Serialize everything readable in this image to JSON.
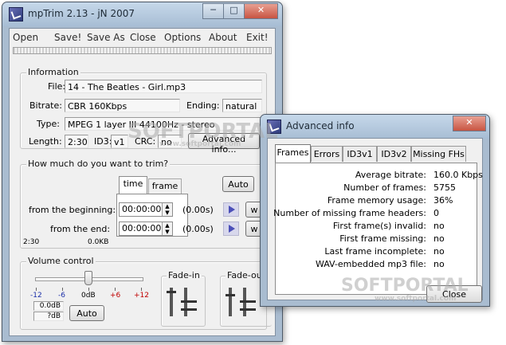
{
  "main_window": {
    "title": "mpTrim 2.13 - jN 2007",
    "caption_minimize": "─",
    "caption_maximize": "□",
    "caption_close": "✕",
    "menu": [
      "Open",
      "Save!",
      "Save As",
      "Close",
      "Options",
      "About",
      "Exit!"
    ],
    "information": {
      "legend": "Information",
      "file_label": "File:",
      "file_value": "14 - The Beatles - Girl.mp3",
      "bitrate_label": "Bitrate:",
      "bitrate_value": "CBR 160Kbps",
      "ending_label": "Ending:",
      "ending_value": "natural",
      "type_label": "Type:",
      "type_value": "MPEG 1 layer III 44100Hz - stereo",
      "length_label": "Length:",
      "length_value": "2:30",
      "id3_label": "ID3:",
      "id3_value": "v1",
      "crc_label": "CRC:",
      "crc_value": "no",
      "advanced_button": "Advanced info..."
    },
    "trim": {
      "legend": "How much do you want to trim?",
      "tabs": [
        "time",
        "frame"
      ],
      "auto_button": "Auto",
      "beginning_label": "from the beginning:",
      "beginning_value": "00:00:00",
      "beginning_seconds": "(0.00s)",
      "end_label": "from the end:",
      "end_value": "00:00:00",
      "end_seconds": "(0.00s)",
      "side_button_label": "w",
      "footer_length": "2:30",
      "footer_size": "0.0KB"
    },
    "volume": {
      "legend": "Volume control",
      "scale": [
        "-12",
        "-6",
        "0dB",
        "+6",
        "+12"
      ],
      "level": 0.5,
      "gain_value": "0.0dB",
      "peak_value": "?dB",
      "auto_button": "Auto",
      "fade_in_legend": "Fade-in",
      "fade_out_legend": "Fade-out"
    }
  },
  "advanced_dialog": {
    "title": "Advanced info",
    "tabs": [
      "Frames",
      "Errors",
      "ID3v1",
      "ID3v2",
      "Missing FHs"
    ],
    "rows": [
      {
        "label": "Average bitrate:",
        "value": "160.0 Kbps"
      },
      {
        "label": "Number of frames:",
        "value": "5755"
      },
      {
        "label": "Frame memory usage:",
        "value": "36%"
      },
      {
        "label": "Number of missing frame headers:",
        "value": "0"
      },
      {
        "label": "First frame(s) invalid:",
        "value": "no"
      },
      {
        "label": "First frame missing:",
        "value": "no"
      },
      {
        "label": "Last frame incomplete:",
        "value": "no"
      },
      {
        "label": "WAV-embedded mp3 file:",
        "value": "no"
      }
    ],
    "close_button": "Close"
  },
  "watermark": {
    "brand": "SOFTPORTAL",
    "url": "www.softportal.com"
  },
  "colors": {
    "window_frame": "#a9bcd0",
    "client_bg": "#f0f0f0",
    "play_arrow": "#4b4fb8",
    "scale_red": "#c00000",
    "scale_blue": "#1a2ea8"
  }
}
